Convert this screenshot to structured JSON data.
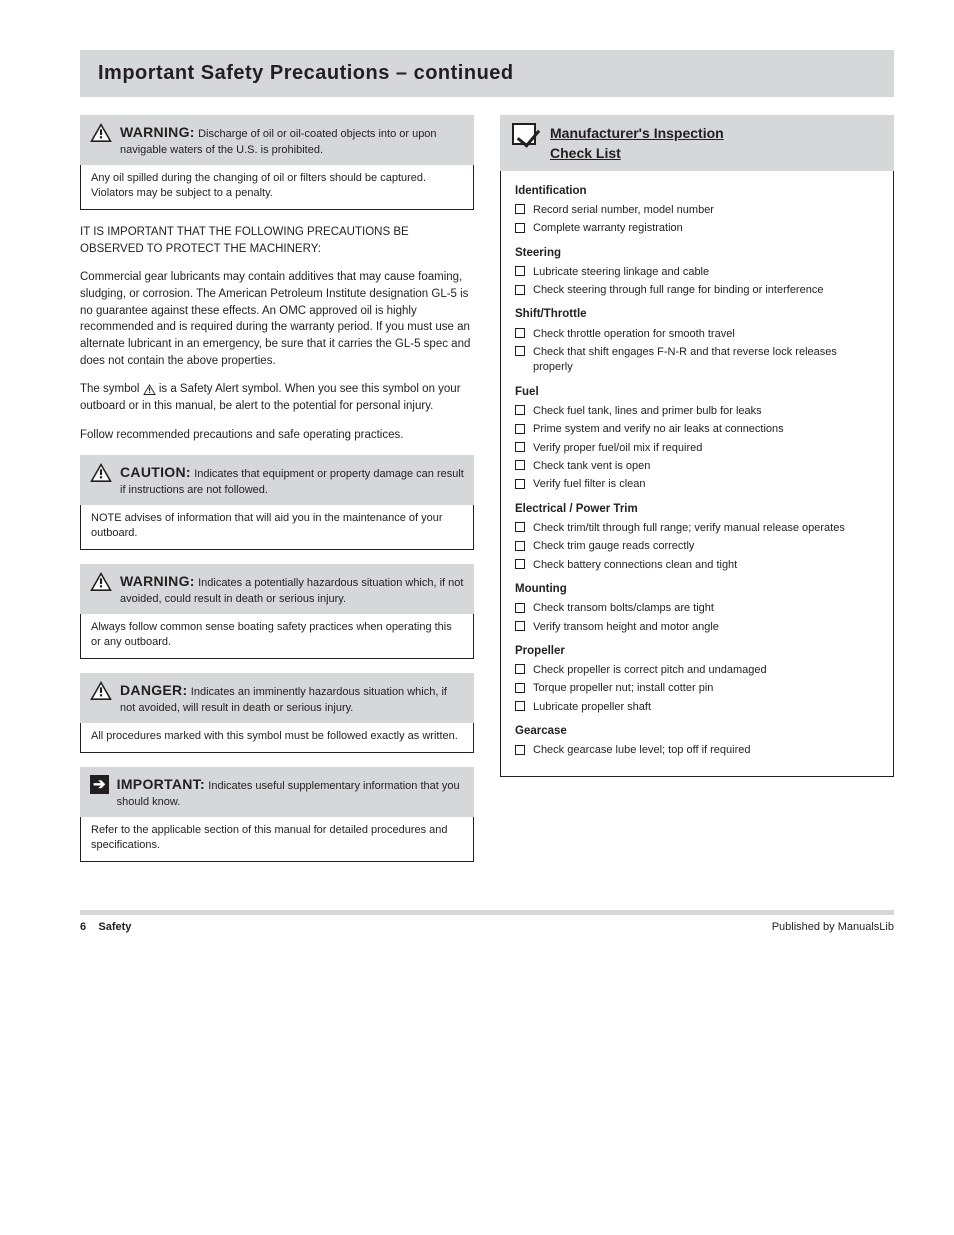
{
  "title": {
    "main": "Important Safety Precautions",
    "continued": " – continued"
  },
  "left": {
    "box1": {
      "label": "WARNING:",
      "suffix": "Discharge of oil or oil-coated objects into or upon navigable waters of the U.S. is prohibited.",
      "body": "Any oil spilled during the changing of oil or filters should be captured. Violators may be subject to a penalty."
    },
    "para1": "IT IS IMPORTANT THAT THE FOLLOWING PRECAUTIONS BE OBSERVED TO PROTECT THE MACHINERY:",
    "para2": "Commercial gear lubricants may contain additives that may cause foaming, sludging, or corrosion. The American Petroleum Institute designation GL-5 is no guarantee against these effects. An OMC approved oil is highly recommended and is required during the warranty period. If you must use an alternate lubricant in an emergency, be sure that it carries the GL-5 spec and does not contain the above properties.",
    "para3_prefix": "The symbol ",
    "para3_suffix": " is a Safety Alert symbol. When you see this symbol on your outboard or in this manual, be alert to the potential for personal injury.",
    "para4": "Follow recommended precautions and safe operating practices.",
    "box2": {
      "label": "CAUTION:",
      "suffix": "Indicates that equipment or property damage can result if instructions are not followed.",
      "body": "NOTE advises of information that will aid you in the maintenance of your outboard."
    },
    "box3": {
      "label": "WARNING:",
      "suffix": "Indicates a potentially hazardous situation which, if not avoided, could result in death or serious injury.",
      "body": "Always follow common sense boating safety practices when operating this or any outboard."
    },
    "box4": {
      "label": "DANGER:",
      "suffix": "Indicates an imminently hazardous situation which, if not avoided, will result in death or serious injury.",
      "body": "All procedures marked with this symbol must be followed exactly as written."
    },
    "box5": {
      "label": "IMPORTANT:",
      "suffix": "Indicates useful supplementary information that you should know.",
      "body": "Refer to the applicable section of this manual for detailed procedures and specifications."
    }
  },
  "right": {
    "heading1": "Manufacturer's Inspection",
    "heading2": "Check List",
    "sections": [
      {
        "title": "Identification",
        "items": [
          "Record serial number, model number",
          "Complete warranty registration"
        ]
      },
      {
        "title": "Steering",
        "items": [
          "Lubricate steering linkage and cable",
          "Check steering through full range for binding or interference"
        ]
      },
      {
        "title": "Shift/Throttle",
        "items": [
          "Check throttle operation for smooth travel",
          "Check that shift engages F-N-R and that reverse lock releases properly"
        ]
      },
      {
        "title": "Fuel",
        "items": [
          "Check fuel tank, lines and primer bulb for leaks",
          "Prime system and verify no air leaks at connections",
          "Verify proper fuel/oil mix if required",
          "Check tank vent is open",
          "Verify fuel filter is clean"
        ]
      },
      {
        "title": "Electrical / Power Trim",
        "items": [
          "Check trim/tilt through full range; verify manual release operates",
          "Check trim gauge reads correctly",
          "Check battery connections clean and tight"
        ]
      },
      {
        "title": "Mounting",
        "items": [
          "Check transom bolts/clamps are tight",
          "Verify transom height and motor angle"
        ]
      },
      {
        "title": "Propeller",
        "items": [
          "Check propeller is correct pitch and undamaged",
          "Torque propeller nut; install cotter pin",
          "Lubricate propeller shaft"
        ]
      },
      {
        "title": "Gearcase",
        "items": [
          "Check gearcase lube level; top off if required"
        ]
      }
    ]
  },
  "footer": {
    "page": "6",
    "left": "Safety",
    "right": "Published by ManualsLib"
  }
}
